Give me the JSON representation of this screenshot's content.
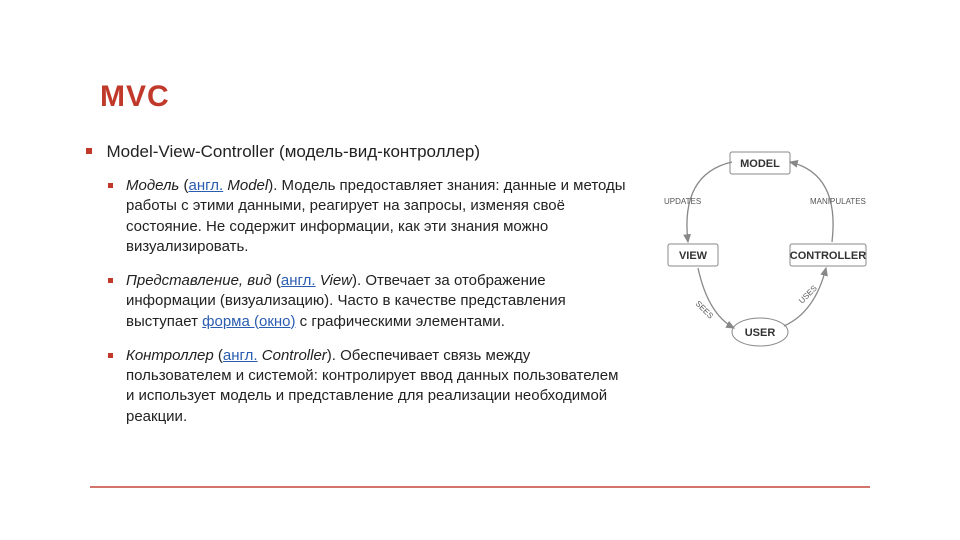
{
  "title": "MVC",
  "heading": "Model-View-Controller (модель-вид-контроллер)",
  "items": [
    {
      "term": "Модель",
      "link1": "англ.",
      "eng": "Model",
      "rest": "). Модель предоставляет знания: данные и методы работы с этими данными, реагирует на запросы, изменяя своё состояние. Не содержит информации, как эти знания можно визуализировать."
    },
    {
      "term": "Представление, вид",
      "link1": "англ.",
      "eng": "View",
      "rest": "). Отвечает за отображение информации (визуализацию). Часто в качестве представления выступает ",
      "link2": "форма (окно)",
      "rest2": " с графическими элементами."
    },
    {
      "term": "Контроллер",
      "link1": "англ.",
      "eng": "Controller",
      "rest": "). Обеспечивает связь между пользователем и системой: контролирует ввод данных пользователем и использует модель и представление для реализации необходимой реакции."
    }
  ],
  "diagram": {
    "model": "MODEL",
    "view": "VIEW",
    "controller": "CONTROLLER",
    "user": "USER",
    "updates": "UPDATES",
    "manipulates": "MANIPULATES",
    "sees": "SEES",
    "uses": "USES"
  }
}
